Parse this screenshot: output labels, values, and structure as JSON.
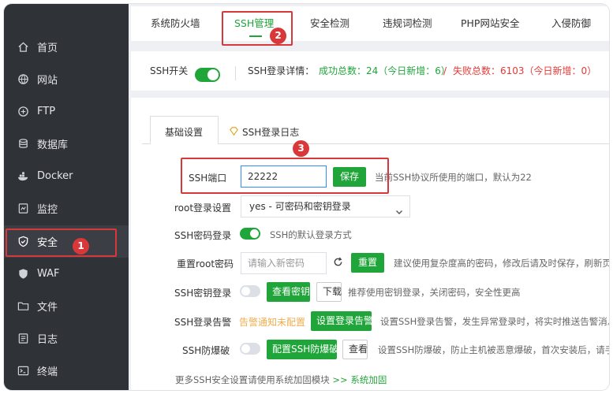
{
  "sidebar": {
    "items": [
      {
        "label": "首页",
        "icon": "home-icon"
      },
      {
        "label": "网站",
        "icon": "globe-icon"
      },
      {
        "label": "FTP",
        "icon": "ftp-icon"
      },
      {
        "label": "数据库",
        "icon": "database-icon"
      },
      {
        "label": "Docker",
        "icon": "docker-icon"
      },
      {
        "label": "监控",
        "icon": "monitor-icon"
      },
      {
        "label": "安全",
        "icon": "shield-icon"
      },
      {
        "label": "WAF",
        "icon": "waf-shield-icon"
      },
      {
        "label": "文件",
        "icon": "folder-icon"
      },
      {
        "label": "日志",
        "icon": "log-icon"
      },
      {
        "label": "终端",
        "icon": "terminal-icon"
      }
    ],
    "active": "安全"
  },
  "tabs": [
    "系统防火墙",
    "SSH管理",
    "安全检测",
    "违规词检测",
    "PHP网站安全",
    "入侵防御"
  ],
  "active_tab": "SSH管理",
  "status": {
    "ssh_switch_label": "SSH开关",
    "ssh_switch_on": true,
    "detail_label": "SSH登录详情：",
    "success": "成功总数：24（今日新增：6）",
    "separator": "/",
    "fail": "失败总数：6103（今日新增：0）",
    "success_color": "#20a53a",
    "fail_color": "#e53935"
  },
  "subtabs": {
    "basic": "基础设置",
    "log": "SSH登录日志"
  },
  "form": {
    "port_label": "SSH端口",
    "port_value": "22222",
    "save_button": "保存",
    "port_hint": "当前SSH协议所使用的端口，默认为22",
    "root_label": "root登录设置",
    "root_value": "yes - 可密码和密钥登录",
    "password_login_label": "SSH密码登录",
    "password_login_on": true,
    "password_login_hint": "SSH的默认登录方式",
    "reset_label": "重置root密码",
    "reset_placeholder": "请输入新密码",
    "reset_button": "重置",
    "reset_hint": "建议使用复杂度高的密码，修改后请及时保存，刷新页面",
    "key_login_label": "SSH密钥登录",
    "key_login_on": false,
    "view_key_button": "查看密钥",
    "download_button": "下载",
    "key_hint": "推荐使用密钥登录，关闭密码，安全性更高",
    "alert_label": "SSH登录告警",
    "alert_status": "告警通知未配置",
    "alert_button": "设置登录告警",
    "alert_hint": "设置SSH登录告警，发生异常登录时，将实时推送告警消息",
    "brute_label": "SSH防爆破",
    "brute_on": false,
    "brute_button": "配置SSH防爆破",
    "brute_view_button": "查看",
    "brute_hint": "设置SSH防爆破，防止主机被恶意爆破，首次安装后，请手动"
  },
  "footer": {
    "text": "更多SSH安全设置请使用系统加固模块",
    "link": ">> 系统加固"
  },
  "annotations": [
    "1",
    "2",
    "3"
  ],
  "colors": {
    "accent": "#20a53a",
    "sidebar_bg": "#2f3237",
    "annotation": "#d9383a"
  }
}
